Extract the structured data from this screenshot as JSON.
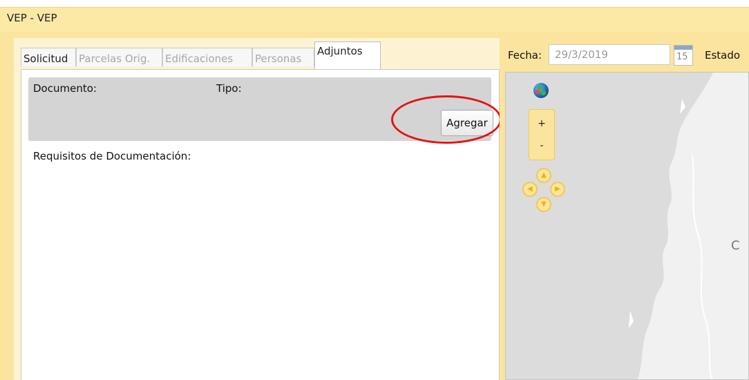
{
  "window": {
    "title": "VEP  -  VEP"
  },
  "tabs": [
    {
      "label": "Solicitud"
    },
    {
      "label": "Parcelas Orig."
    },
    {
      "label": "Edificaciones"
    },
    {
      "label": "Personas"
    },
    {
      "label": "Adjuntos"
    }
  ],
  "adjuntos": {
    "documento_label": "Documento:",
    "tipo_label": "Tipo:",
    "add_button": "Agregar",
    "requisitos_label": "Requisitos de Documentación:"
  },
  "header": {
    "fecha_label": "Fecha:",
    "fecha_value": "29/3/2019",
    "calendar_number": "15",
    "estado_label": "Estado"
  },
  "map": {
    "zoom_in": "+",
    "zoom_out": "-",
    "label_c": "C"
  },
  "colors": {
    "titlebar": "#fde9a6",
    "frame": "#fbe49e",
    "highlight_circle": "#e31414",
    "map_background": "#dcdcdc"
  }
}
